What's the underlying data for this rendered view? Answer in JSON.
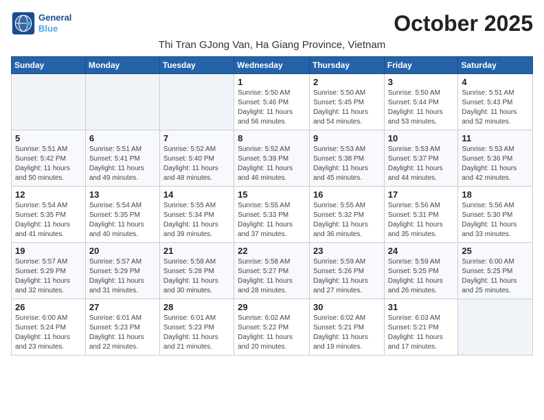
{
  "header": {
    "logo_line1": "General",
    "logo_line2": "Blue",
    "month_title": "October 2025",
    "subtitle": "Thi Tran GJong Van, Ha Giang Province, Vietnam"
  },
  "weekdays": [
    "Sunday",
    "Monday",
    "Tuesday",
    "Wednesday",
    "Thursday",
    "Friday",
    "Saturday"
  ],
  "weeks": [
    [
      {
        "day": "",
        "info": ""
      },
      {
        "day": "",
        "info": ""
      },
      {
        "day": "",
        "info": ""
      },
      {
        "day": "1",
        "info": "Sunrise: 5:50 AM\nSunset: 5:46 PM\nDaylight: 11 hours\nand 56 minutes."
      },
      {
        "day": "2",
        "info": "Sunrise: 5:50 AM\nSunset: 5:45 PM\nDaylight: 11 hours\nand 54 minutes."
      },
      {
        "day": "3",
        "info": "Sunrise: 5:50 AM\nSunset: 5:44 PM\nDaylight: 11 hours\nand 53 minutes."
      },
      {
        "day": "4",
        "info": "Sunrise: 5:51 AM\nSunset: 5:43 PM\nDaylight: 11 hours\nand 52 minutes."
      }
    ],
    [
      {
        "day": "5",
        "info": "Sunrise: 5:51 AM\nSunset: 5:42 PM\nDaylight: 11 hours\nand 50 minutes."
      },
      {
        "day": "6",
        "info": "Sunrise: 5:51 AM\nSunset: 5:41 PM\nDaylight: 11 hours\nand 49 minutes."
      },
      {
        "day": "7",
        "info": "Sunrise: 5:52 AM\nSunset: 5:40 PM\nDaylight: 11 hours\nand 48 minutes."
      },
      {
        "day": "8",
        "info": "Sunrise: 5:52 AM\nSunset: 5:39 PM\nDaylight: 11 hours\nand 46 minutes."
      },
      {
        "day": "9",
        "info": "Sunrise: 5:53 AM\nSunset: 5:38 PM\nDaylight: 11 hours\nand 45 minutes."
      },
      {
        "day": "10",
        "info": "Sunrise: 5:53 AM\nSunset: 5:37 PM\nDaylight: 11 hours\nand 44 minutes."
      },
      {
        "day": "11",
        "info": "Sunrise: 5:53 AM\nSunset: 5:36 PM\nDaylight: 11 hours\nand 42 minutes."
      }
    ],
    [
      {
        "day": "12",
        "info": "Sunrise: 5:54 AM\nSunset: 5:35 PM\nDaylight: 11 hours\nand 41 minutes."
      },
      {
        "day": "13",
        "info": "Sunrise: 5:54 AM\nSunset: 5:35 PM\nDaylight: 11 hours\nand 40 minutes."
      },
      {
        "day": "14",
        "info": "Sunrise: 5:55 AM\nSunset: 5:34 PM\nDaylight: 11 hours\nand 39 minutes."
      },
      {
        "day": "15",
        "info": "Sunrise: 5:55 AM\nSunset: 5:33 PM\nDaylight: 11 hours\nand 37 minutes."
      },
      {
        "day": "16",
        "info": "Sunrise: 5:55 AM\nSunset: 5:32 PM\nDaylight: 11 hours\nand 36 minutes."
      },
      {
        "day": "17",
        "info": "Sunrise: 5:56 AM\nSunset: 5:31 PM\nDaylight: 11 hours\nand 35 minutes."
      },
      {
        "day": "18",
        "info": "Sunrise: 5:56 AM\nSunset: 5:30 PM\nDaylight: 11 hours\nand 33 minutes."
      }
    ],
    [
      {
        "day": "19",
        "info": "Sunrise: 5:57 AM\nSunset: 5:29 PM\nDaylight: 11 hours\nand 32 minutes."
      },
      {
        "day": "20",
        "info": "Sunrise: 5:57 AM\nSunset: 5:29 PM\nDaylight: 11 hours\nand 31 minutes."
      },
      {
        "day": "21",
        "info": "Sunrise: 5:58 AM\nSunset: 5:28 PM\nDaylight: 11 hours\nand 30 minutes."
      },
      {
        "day": "22",
        "info": "Sunrise: 5:58 AM\nSunset: 5:27 PM\nDaylight: 11 hours\nand 28 minutes."
      },
      {
        "day": "23",
        "info": "Sunrise: 5:59 AM\nSunset: 5:26 PM\nDaylight: 11 hours\nand 27 minutes."
      },
      {
        "day": "24",
        "info": "Sunrise: 5:59 AM\nSunset: 5:25 PM\nDaylight: 11 hours\nand 26 minutes."
      },
      {
        "day": "25",
        "info": "Sunrise: 6:00 AM\nSunset: 5:25 PM\nDaylight: 11 hours\nand 25 minutes."
      }
    ],
    [
      {
        "day": "26",
        "info": "Sunrise: 6:00 AM\nSunset: 5:24 PM\nDaylight: 11 hours\nand 23 minutes."
      },
      {
        "day": "27",
        "info": "Sunrise: 6:01 AM\nSunset: 5:23 PM\nDaylight: 11 hours\nand 22 minutes."
      },
      {
        "day": "28",
        "info": "Sunrise: 6:01 AM\nSunset: 5:23 PM\nDaylight: 11 hours\nand 21 minutes."
      },
      {
        "day": "29",
        "info": "Sunrise: 6:02 AM\nSunset: 5:22 PM\nDaylight: 11 hours\nand 20 minutes."
      },
      {
        "day": "30",
        "info": "Sunrise: 6:02 AM\nSunset: 5:21 PM\nDaylight: 11 hours\nand 19 minutes."
      },
      {
        "day": "31",
        "info": "Sunrise: 6:03 AM\nSunset: 5:21 PM\nDaylight: 11 hours\nand 17 minutes."
      },
      {
        "day": "",
        "info": ""
      }
    ]
  ]
}
